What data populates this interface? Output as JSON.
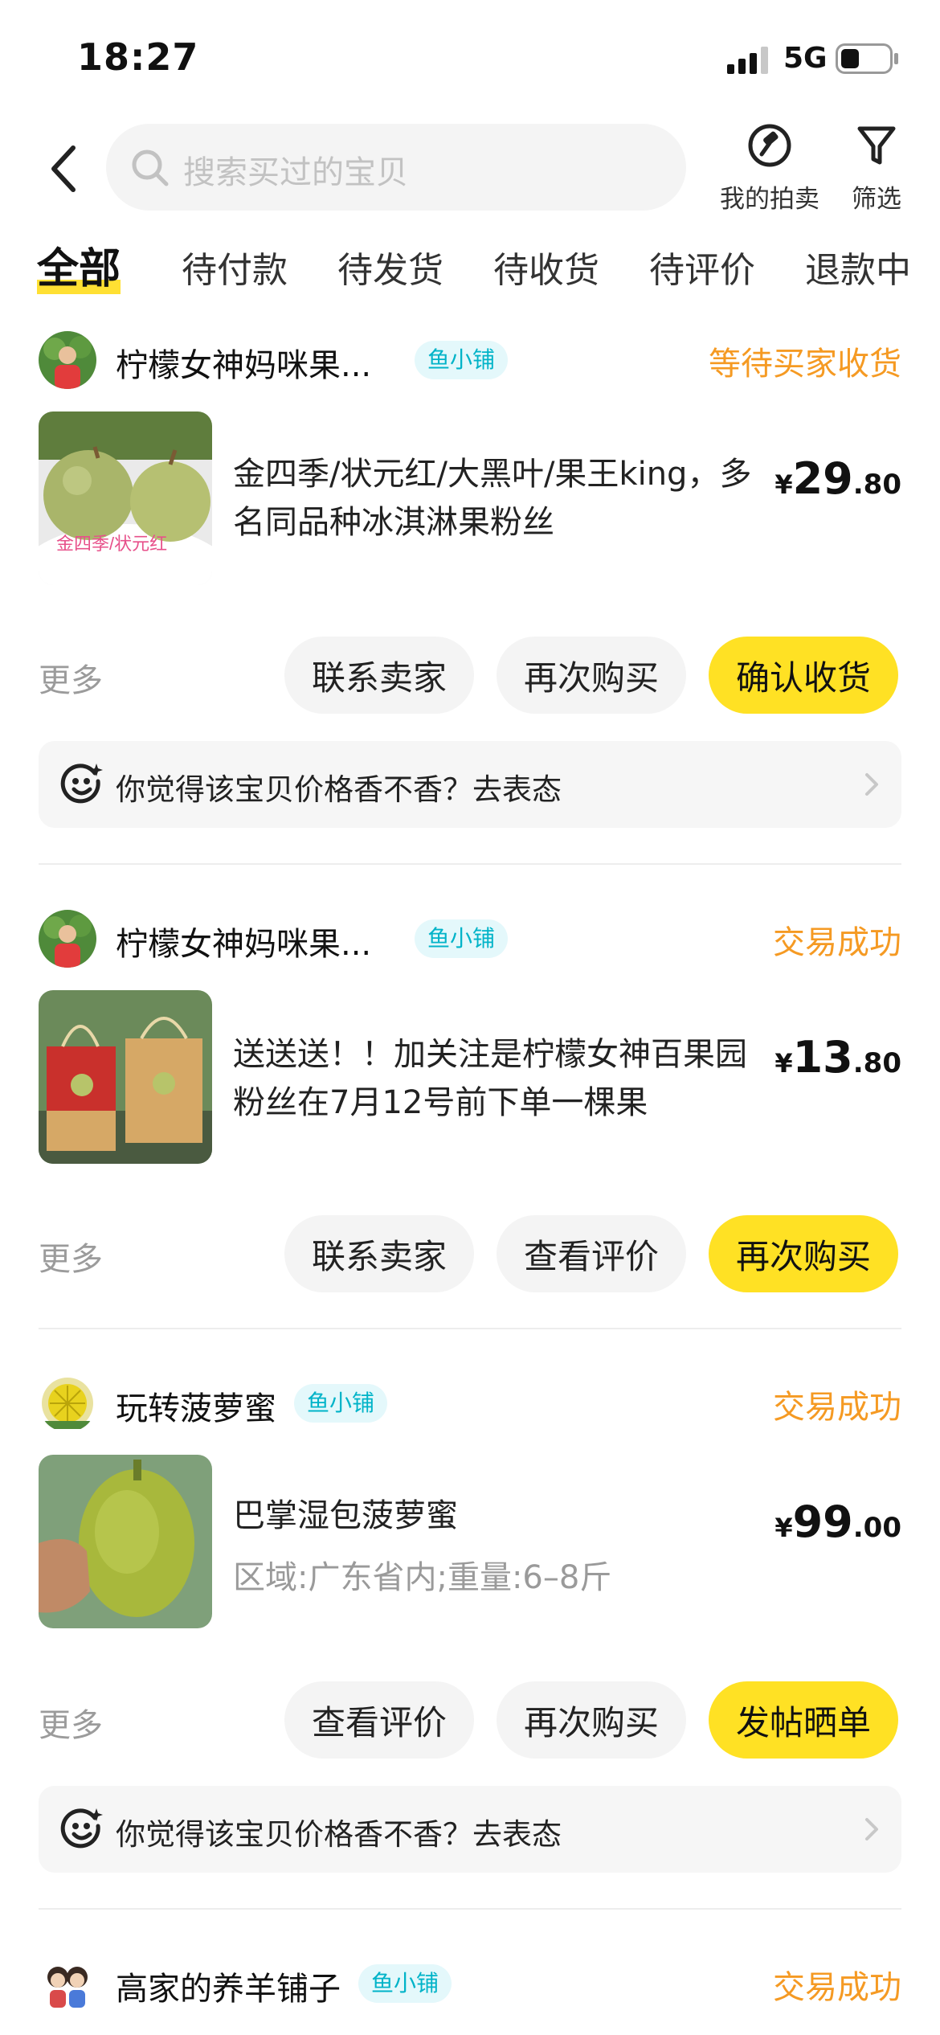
{
  "status_bar": {
    "time": "18:27",
    "network": "5G"
  },
  "nav": {
    "search_placeholder": "搜索买过的宝贝",
    "actions": [
      {
        "label": "我的拍卖",
        "icon": "auction-icon"
      },
      {
        "label": "筛选",
        "icon": "filter-icon"
      }
    ]
  },
  "tabs": [
    {
      "label": "全部",
      "active": true
    },
    {
      "label": "待付款"
    },
    {
      "label": "待发货"
    },
    {
      "label": "待收货"
    },
    {
      "label": "待评价"
    },
    {
      "label": "退款中"
    }
  ],
  "orders": [
    {
      "shop_name": "柠檬女神妈咪果...",
      "badge": "鱼小铺",
      "status": "等待买家收货",
      "title": "金四季/状元红/大黑叶/果王king，多名同品种冰淇淋果粉丝",
      "subtitle": "",
      "thumb_text": "金四季/状元红",
      "price": {
        "currency": "¥",
        "integer": "29",
        "decimal": ".80"
      },
      "more": "更多",
      "buttons": [
        "联系卖家",
        "再次购买",
        "确认收货"
      ],
      "feedback": "你觉得该宝贝价格香不香？去表态"
    },
    {
      "shop_name": "柠檬女神妈咪果...",
      "badge": "鱼小铺",
      "status": "交易成功",
      "title": "送送送！！加关注是柠檬女神百果园粉丝在7月12号前下单一棵果",
      "subtitle": "",
      "price": {
        "currency": "¥",
        "integer": "13",
        "decimal": ".80"
      },
      "more": "更多",
      "buttons": [
        "联系卖家",
        "查看评价",
        "再次购买"
      ]
    },
    {
      "shop_name": "玩转菠萝蜜",
      "badge": "鱼小铺",
      "status": "交易成功",
      "title": "巴掌湿包菠萝蜜",
      "subtitle": "区域:广东省内;重量:6–8斤",
      "price": {
        "currency": "¥",
        "integer": "99",
        "decimal": ".00"
      },
      "more": "更多",
      "buttons": [
        "查看评价",
        "再次购买",
        "发帖晒单"
      ],
      "feedback": "你觉得该宝贝价格香不香？去表态"
    },
    {
      "shop_name": "高家的养羊铺子",
      "badge": "鱼小铺",
      "status": "交易成功"
    }
  ]
}
